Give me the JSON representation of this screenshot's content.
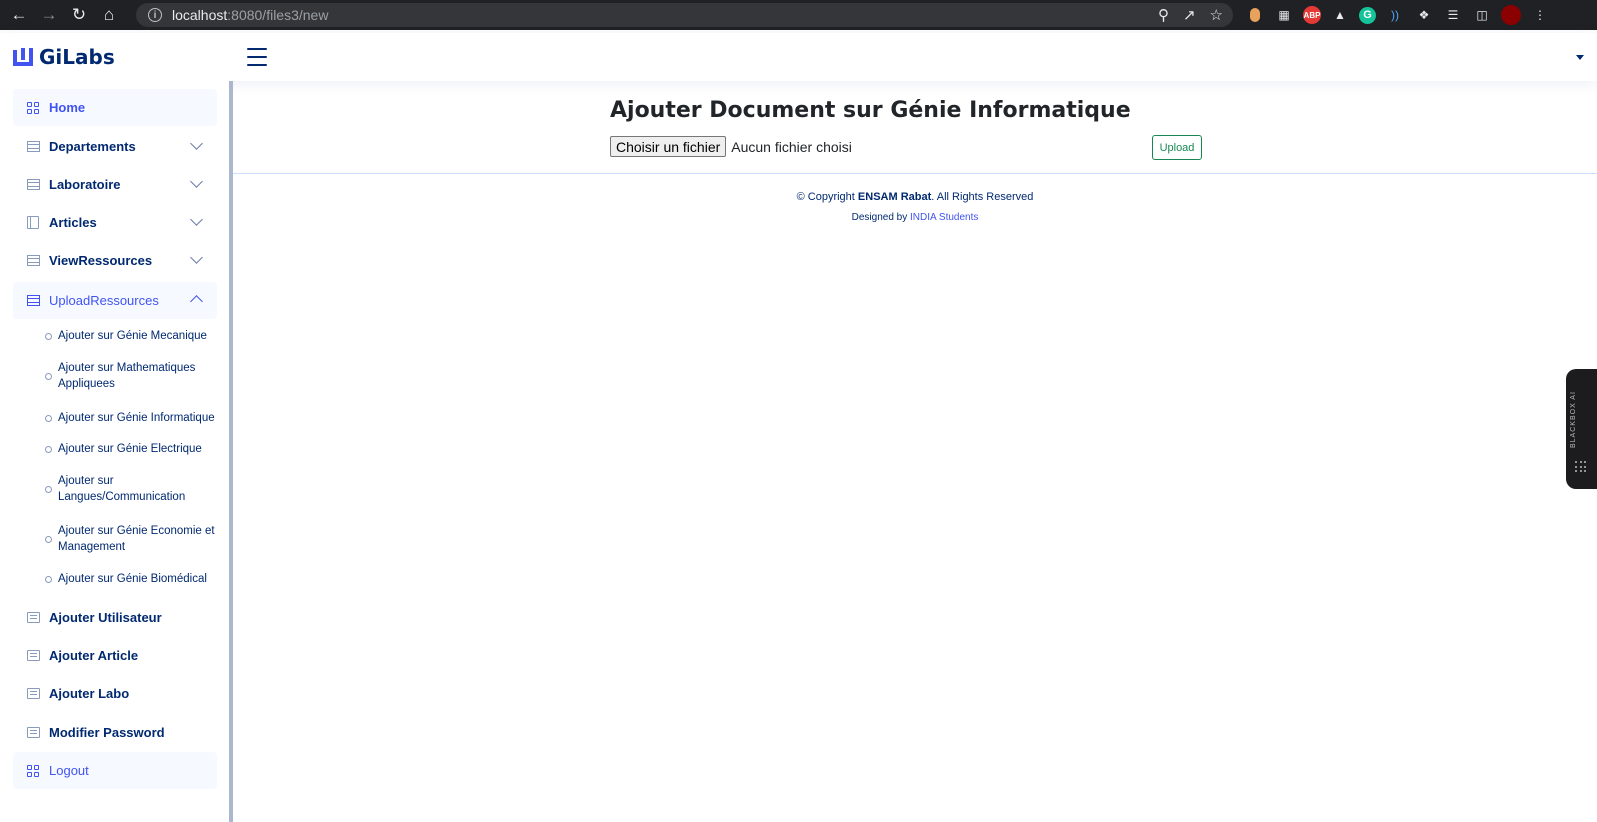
{
  "browser": {
    "url_host": "localhost",
    "url_rest": ":8080/files3/new",
    "extensions": [
      "pill-icon",
      "grid-apps-icon",
      "ABP",
      "hat-icon",
      "G",
      "wifi-icon",
      "puzzle-icon",
      "media-list-icon",
      "sidebar-icon",
      "avatar"
    ]
  },
  "header": {
    "brand": "GiLabs"
  },
  "sidebar": {
    "items": [
      {
        "label": "Home",
        "icon": "grid-icon"
      },
      {
        "label": "Departements",
        "icon": "table-icon"
      },
      {
        "label": "Laboratoire",
        "icon": "table-icon"
      },
      {
        "label": "Articles",
        "icon": "journal-icon"
      },
      {
        "label": "ViewRessources",
        "icon": "table-icon"
      },
      {
        "label": "UploadRessources",
        "icon": "table-icon"
      },
      {
        "label": "Ajouter Utilisateur",
        "icon": "list-icon"
      },
      {
        "label": "Ajouter Article",
        "icon": "list-icon"
      },
      {
        "label": "Ajouter Labo",
        "icon": "list-icon"
      },
      {
        "label": "Modifier Password",
        "icon": "list-icon"
      },
      {
        "label": "Logout",
        "icon": "grid-icon"
      }
    ],
    "upload_sub": [
      "Ajouter sur Génie Mecanique",
      "Ajouter sur Mathematiques Appliquees",
      "Ajouter sur Génie Informatique",
      "Ajouter sur Génie Electrique",
      "Ajouter sur Langues/Communication",
      "Ajouter sur Génie Economie et Management",
      "Ajouter sur Génie Biomédical"
    ]
  },
  "main": {
    "title": "Ajouter Document sur Génie Informatique",
    "file_button": "Choisir un fichier",
    "file_status": "Aucun fichier choisi",
    "upload_label": "Upload"
  },
  "footer": {
    "copyright_prefix": "© Copyright",
    "org": "ENSAM Rabat",
    "copyright_suffix": ". All Rights Reserved",
    "designed_prefix": "Designed by",
    "designed_by": "INDIA Students"
  },
  "widget": {
    "label": "BLACKBOX AI"
  },
  "colors": {
    "accent": "#4154f1",
    "navy": "#012970",
    "success": "#198754"
  }
}
